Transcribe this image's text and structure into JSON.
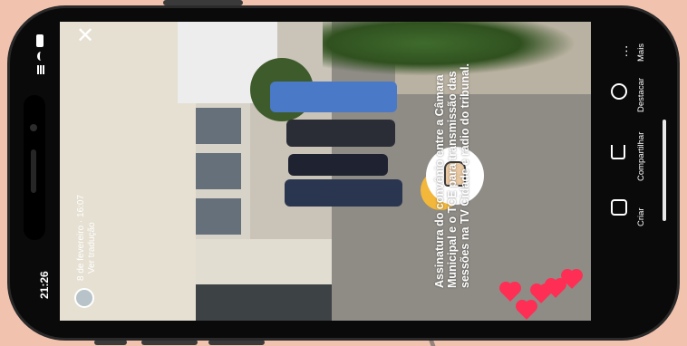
{
  "status": {
    "time": "21:26"
  },
  "video": {
    "caption": "Assinatura do convênio entre a Câmara Municipal e o TCE para transmissão das sessões na TV Cidade e rádio do tribunal.",
    "date": "8 de fevereiro · 16:07",
    "translate": "Ver tradução"
  },
  "actions": {
    "more": "Mais",
    "highlight": "Destacar",
    "share": "Compartilhar",
    "create": "Criar"
  },
  "icons": [
    "close-icon",
    "signal-icon",
    "wifi-icon",
    "battery-icon",
    "more-icon",
    "highlight-icon",
    "share-icon",
    "create-icon",
    "heart-icon",
    "hand-sticker-icon",
    "globe-icon"
  ],
  "colors": {
    "background": "#f1c3ae",
    "heart": "#ff2e54",
    "sticker": "#f2b73b"
  }
}
